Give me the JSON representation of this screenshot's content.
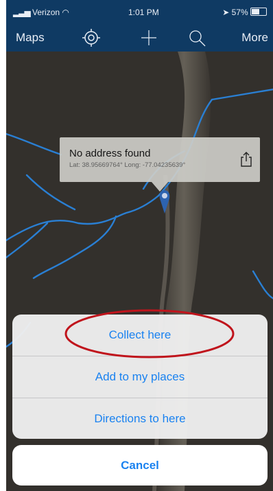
{
  "status_bar": {
    "carrier": "Verizon",
    "time": "1:01 PM",
    "battery": "57%"
  },
  "nav_bar": {
    "maps_label": "Maps",
    "more_label": "More",
    "icons": [
      "locate-icon",
      "plus-icon",
      "search-icon"
    ]
  },
  "callout": {
    "title": "No address found",
    "coordinates": "Lat: 38.95669764° Long: -77.04235639°",
    "share_icon": "share-icon"
  },
  "action_sheet": {
    "items": [
      {
        "label": "Collect here"
      },
      {
        "label": "Add to my places"
      },
      {
        "label": "Directions to here"
      }
    ],
    "cancel_label": "Cancel"
  },
  "annotation": {
    "highlight_color": "#c0141c"
  },
  "colors": {
    "nav_bg": "#0f3a63",
    "action_text": "#1a82f0",
    "stream": "#2a7fd3",
    "pin": "#2d63b0"
  }
}
